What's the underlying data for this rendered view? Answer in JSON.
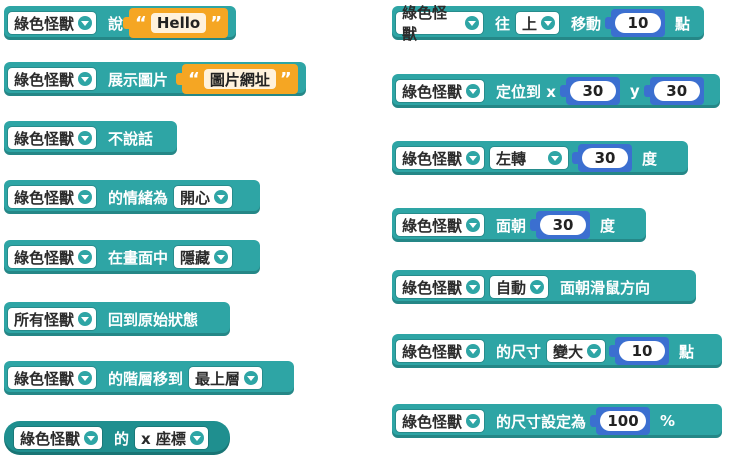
{
  "colors": {
    "block": "#2ea5a5",
    "reporter": "#1f8f8f",
    "number_slot": "#3b6fd0",
    "string_slot": "#f5a623"
  },
  "sprite": "綠色怪獸",
  "all_sprites": "所有怪獸",
  "left": {
    "say": {
      "verb": "說",
      "value": "Hello"
    },
    "show_image": {
      "verb": "展示圖片",
      "value": "圖片網址"
    },
    "stop_talking": {
      "verb": "不說話"
    },
    "mood": {
      "verb": "的情緒為",
      "option": "開心"
    },
    "visibility": {
      "verb": "在畫面中",
      "option": "隱藏"
    },
    "reset": {
      "verb": "回到原始狀態"
    },
    "layer": {
      "verb": "的階層移到",
      "option": "最上層"
    },
    "reporter": {
      "verb": "的",
      "option": "x 座標"
    }
  },
  "right": {
    "move": {
      "verb": "往",
      "dir": "上",
      "verb2": "移動",
      "value": "10",
      "unit": "點"
    },
    "goto": {
      "verb": "定位到 x",
      "x": "30",
      "ylabel": "y",
      "y": "30"
    },
    "turn": {
      "option": "左轉",
      "value": "30",
      "unit": "度"
    },
    "face": {
      "verb": "面朝",
      "value": "30",
      "unit": "度"
    },
    "auto_face": {
      "option": "自動",
      "verb": "面朝滑鼠方向"
    },
    "size_change": {
      "verb": "的尺寸",
      "option": "變大",
      "value": "10",
      "unit": "點"
    },
    "size_set": {
      "verb": "的尺寸設定為",
      "value": "100",
      "unit": "%"
    }
  }
}
